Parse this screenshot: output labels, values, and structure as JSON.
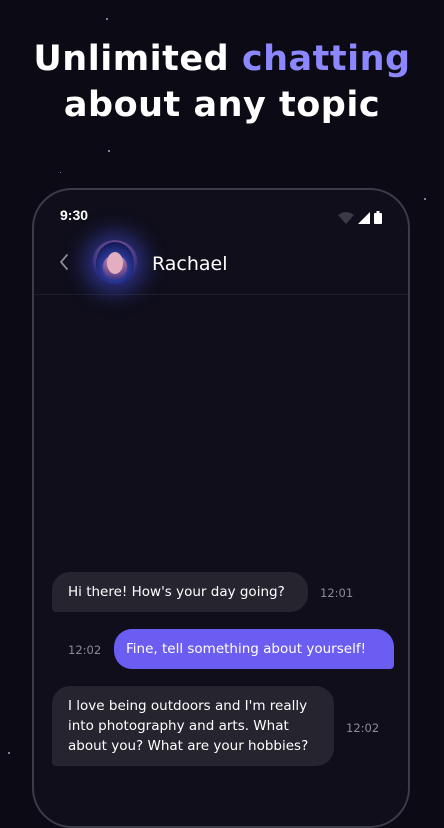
{
  "headline": {
    "line1_prefix": "Unlimited ",
    "line1_accent": "chatting",
    "line2": "about any topic"
  },
  "status_bar": {
    "time": "9:30"
  },
  "chat_header": {
    "contact_name": "Rachael"
  },
  "messages": [
    {
      "direction": "incoming",
      "text": "Hi there! How's your day going?",
      "time": "12:01"
    },
    {
      "direction": "outgoing",
      "text": "Fine, tell something about yourself!",
      "time": "12:02"
    },
    {
      "direction": "incoming",
      "text": "I love being outdoors and I'm really into photography and arts. What about you? What are your hobbies?",
      "time": "12:02"
    }
  ],
  "colors": {
    "background": "#0c0b15",
    "accent": "#8c86ff",
    "outgoing_bubble": "#6b5cf2",
    "incoming_bubble": "#25242f"
  }
}
